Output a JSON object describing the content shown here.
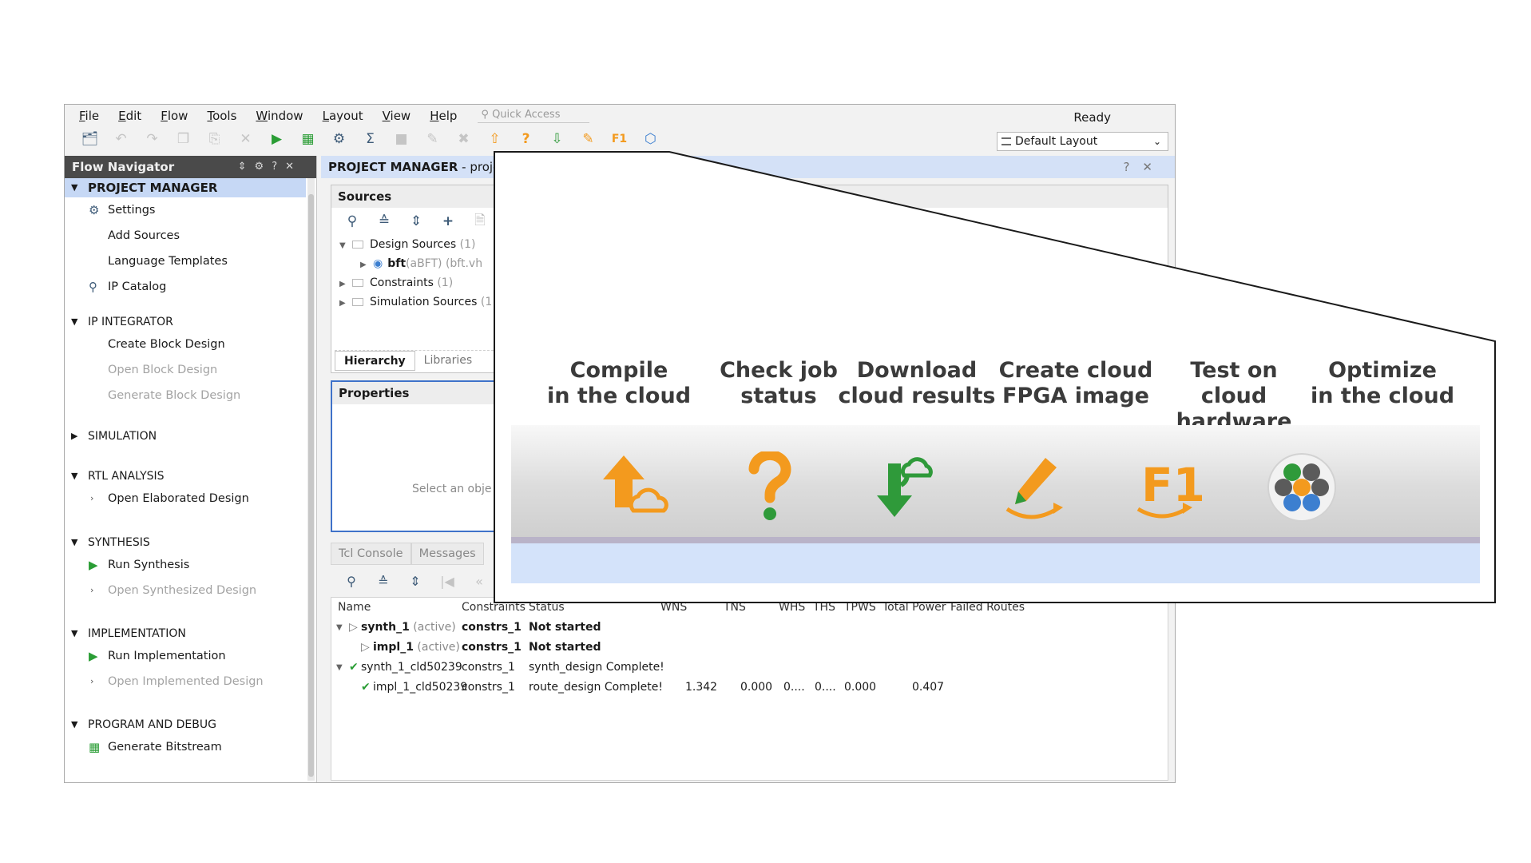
{
  "menubar": {
    "items": [
      "File",
      "Edit",
      "Flow",
      "Tools",
      "Window",
      "Layout",
      "View",
      "Help"
    ],
    "quick_access_placeholder": "Quick Access",
    "status": "Ready"
  },
  "toolbar": {
    "layout_select": "Default Layout"
  },
  "flow_navigator": {
    "title": "Flow Navigator",
    "sections": [
      {
        "title": "PROJECT MANAGER",
        "items": [
          "Settings",
          "Add Sources",
          "Language Templates",
          "IP Catalog"
        ]
      },
      {
        "title": "IP INTEGRATOR",
        "items": [
          "Create Block Design",
          "Open Block Design",
          "Generate Block Design"
        ]
      },
      {
        "title": "SIMULATION",
        "items": []
      },
      {
        "title": "RTL ANALYSIS",
        "items": [
          "Open Elaborated Design"
        ]
      },
      {
        "title": "SYNTHESIS",
        "items": [
          "Run Synthesis",
          "Open Synthesized Design"
        ]
      },
      {
        "title": "IMPLEMENTATION",
        "items": [
          "Run Implementation",
          "Open Implemented Design"
        ]
      },
      {
        "title": "PROGRAM AND DEBUG",
        "items": [
          "Generate Bitstream"
        ]
      }
    ]
  },
  "project_manager": {
    "title": "PROJECT MANAGER",
    "title_suffix": " - projec",
    "sources": {
      "title": "Sources",
      "tree": {
        "design_sources": "Design Sources",
        "design_sources_count": "(1)",
        "bft_name": "bft",
        "bft_detail": "(aBFT) (bft.vh",
        "constraints": "Constraints",
        "constraints_count": "(1)",
        "simulation_sources": "Simulation Sources",
        "simulation_sources_count": "(1"
      },
      "tabs": [
        "Hierarchy",
        "Libraries"
      ]
    },
    "properties": {
      "title": "Properties",
      "empty_text": "Select an obje"
    },
    "console_tabs": [
      "Tcl Console",
      "Messages"
    ]
  },
  "runs": {
    "columns": [
      "Name",
      "Constraints",
      "Status",
      "WNS",
      "TNS",
      "WHS",
      "THS",
      "TPWS",
      "Total Power",
      "Failed Routes"
    ],
    "rows": [
      {
        "name": "synth_1",
        "tag": "(active)",
        "constraints": "constrs_1",
        "status": "Not started",
        "wns": "",
        "tns": "",
        "whs": "",
        "ths": "",
        "tpws": "",
        "power": ""
      },
      {
        "name": "impl_1",
        "tag": "(active)",
        "constraints": "constrs_1",
        "status": "Not started",
        "wns": "",
        "tns": "",
        "whs": "",
        "ths": "",
        "tpws": "",
        "power": ""
      },
      {
        "name": "synth_1_cld50239",
        "tag": "",
        "constraints": "constrs_1",
        "status": "synth_design Complete!",
        "wns": "",
        "tns": "",
        "whs": "",
        "ths": "",
        "tpws": "",
        "power": ""
      },
      {
        "name": "impl_1_cld50239",
        "tag": "",
        "constraints": "constrs_1",
        "status": "route_design Complete!",
        "wns": "1.342",
        "tns": "0.000",
        "whs": "0....",
        "ths": "0....",
        "tpws": "0.000",
        "power": "0.407"
      }
    ]
  },
  "callout": {
    "buttons": [
      {
        "line1": "Compile",
        "line2": "in the cloud",
        "icon": "upload-cloud-icon",
        "color": "#f39a1e"
      },
      {
        "line1": "Check job",
        "line2": "status",
        "icon": "question-icon",
        "color": "#f39a1e"
      },
      {
        "line1": "Download",
        "line2": "cloud results",
        "icon": "download-cloud-icon",
        "color": "#2f9a3a"
      },
      {
        "line1": "Create cloud",
        "line2": "FPGA image",
        "icon": "pencil-icon",
        "color": "#f39a1e"
      },
      {
        "line1": "Test on cloud",
        "line2": "hardware",
        "icon": "f1-icon",
        "color": "#f39a1e"
      },
      {
        "line1": "Optimize",
        "line2": "in the cloud",
        "icon": "hexagon-cluster-icon",
        "color": "#3c7fd0"
      }
    ]
  }
}
